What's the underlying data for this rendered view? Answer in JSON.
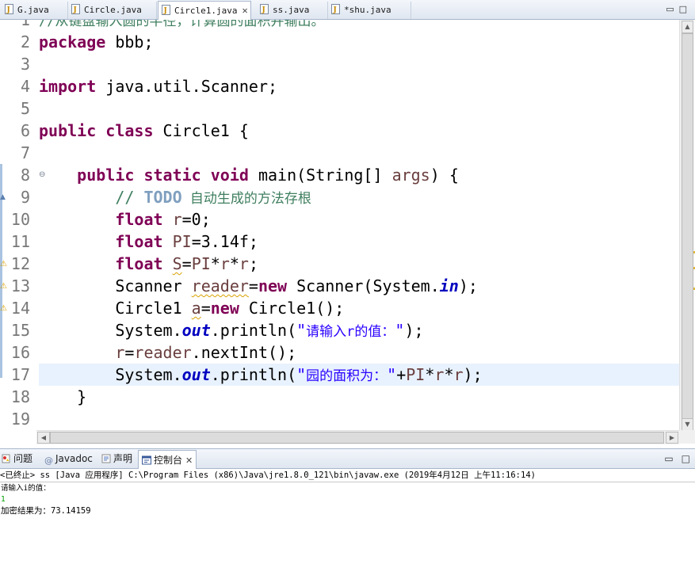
{
  "editor_tabs": [
    {
      "label": "G.java",
      "active": false
    },
    {
      "label": "Circle.java",
      "active": false
    },
    {
      "label": "Circle1.java",
      "active": true
    },
    {
      "label": "ss.java",
      "active": false
    },
    {
      "label": "*shu.java",
      "active": false
    }
  ],
  "code_lines": [
    {
      "n": "1",
      "text": "//从键盘输入圆的半径，计算圆的面积并输出。"
    },
    {
      "n": "2",
      "text": "package bbb;"
    },
    {
      "n": "3",
      "text": ""
    },
    {
      "n": "4",
      "text": "import java.util.Scanner;"
    },
    {
      "n": "5",
      "text": ""
    },
    {
      "n": "6",
      "text": "public class Circle1 {"
    },
    {
      "n": "7",
      "text": ""
    },
    {
      "n": "8",
      "text": "    public static void main(String[] args) {"
    },
    {
      "n": "9",
      "text": "        // TODO 自动生成的方法存根"
    },
    {
      "n": "10",
      "text": "        float r=0;"
    },
    {
      "n": "11",
      "text": "        float PI=3.14f;"
    },
    {
      "n": "12",
      "text": "        float S=PI*r*r;"
    },
    {
      "n": "13",
      "text": "        Scanner reader=new Scanner(System.in);"
    },
    {
      "n": "14",
      "text": "        Circle1 a=new Circle1();"
    },
    {
      "n": "15",
      "text": "        System.out.println(\"请输入r的值：\");"
    },
    {
      "n": "16",
      "text": "        r=reader.nextInt();"
    },
    {
      "n": "17",
      "text": "        System.out.println(\"园的面积为：\"+PI*r*r);"
    },
    {
      "n": "18",
      "text": "    }"
    },
    {
      "n": "19",
      "text": ""
    }
  ],
  "view_tabs": [
    {
      "label": "问题",
      "icon": "problems-icon",
      "active": false
    },
    {
      "label": "Javadoc",
      "icon": "javadoc-icon",
      "active": false
    },
    {
      "label": "声明",
      "icon": "declaration-icon",
      "active": false
    },
    {
      "label": "控制台",
      "icon": "console-icon",
      "active": true
    }
  ],
  "console": {
    "header": "<已终止> ss [Java 应用程序] C:\\Program Files (x86)\\Java\\jre1.8.0_121\\bin\\javaw.exe (2019年4月12日 上午11:16:14)",
    "lines": [
      {
        "text": "请输入i的值：",
        "kind": "output"
      },
      {
        "text": "1",
        "kind": "input"
      },
      {
        "text": "加密结果为：73.14159",
        "kind": "output"
      }
    ]
  },
  "colors": {
    "keyword": "#7f0055",
    "comment": "#3f7f5f",
    "string": "#2a00ff",
    "field": "#0000c0",
    "current_line": "#e8f2fe",
    "console_input": "#00a000"
  }
}
